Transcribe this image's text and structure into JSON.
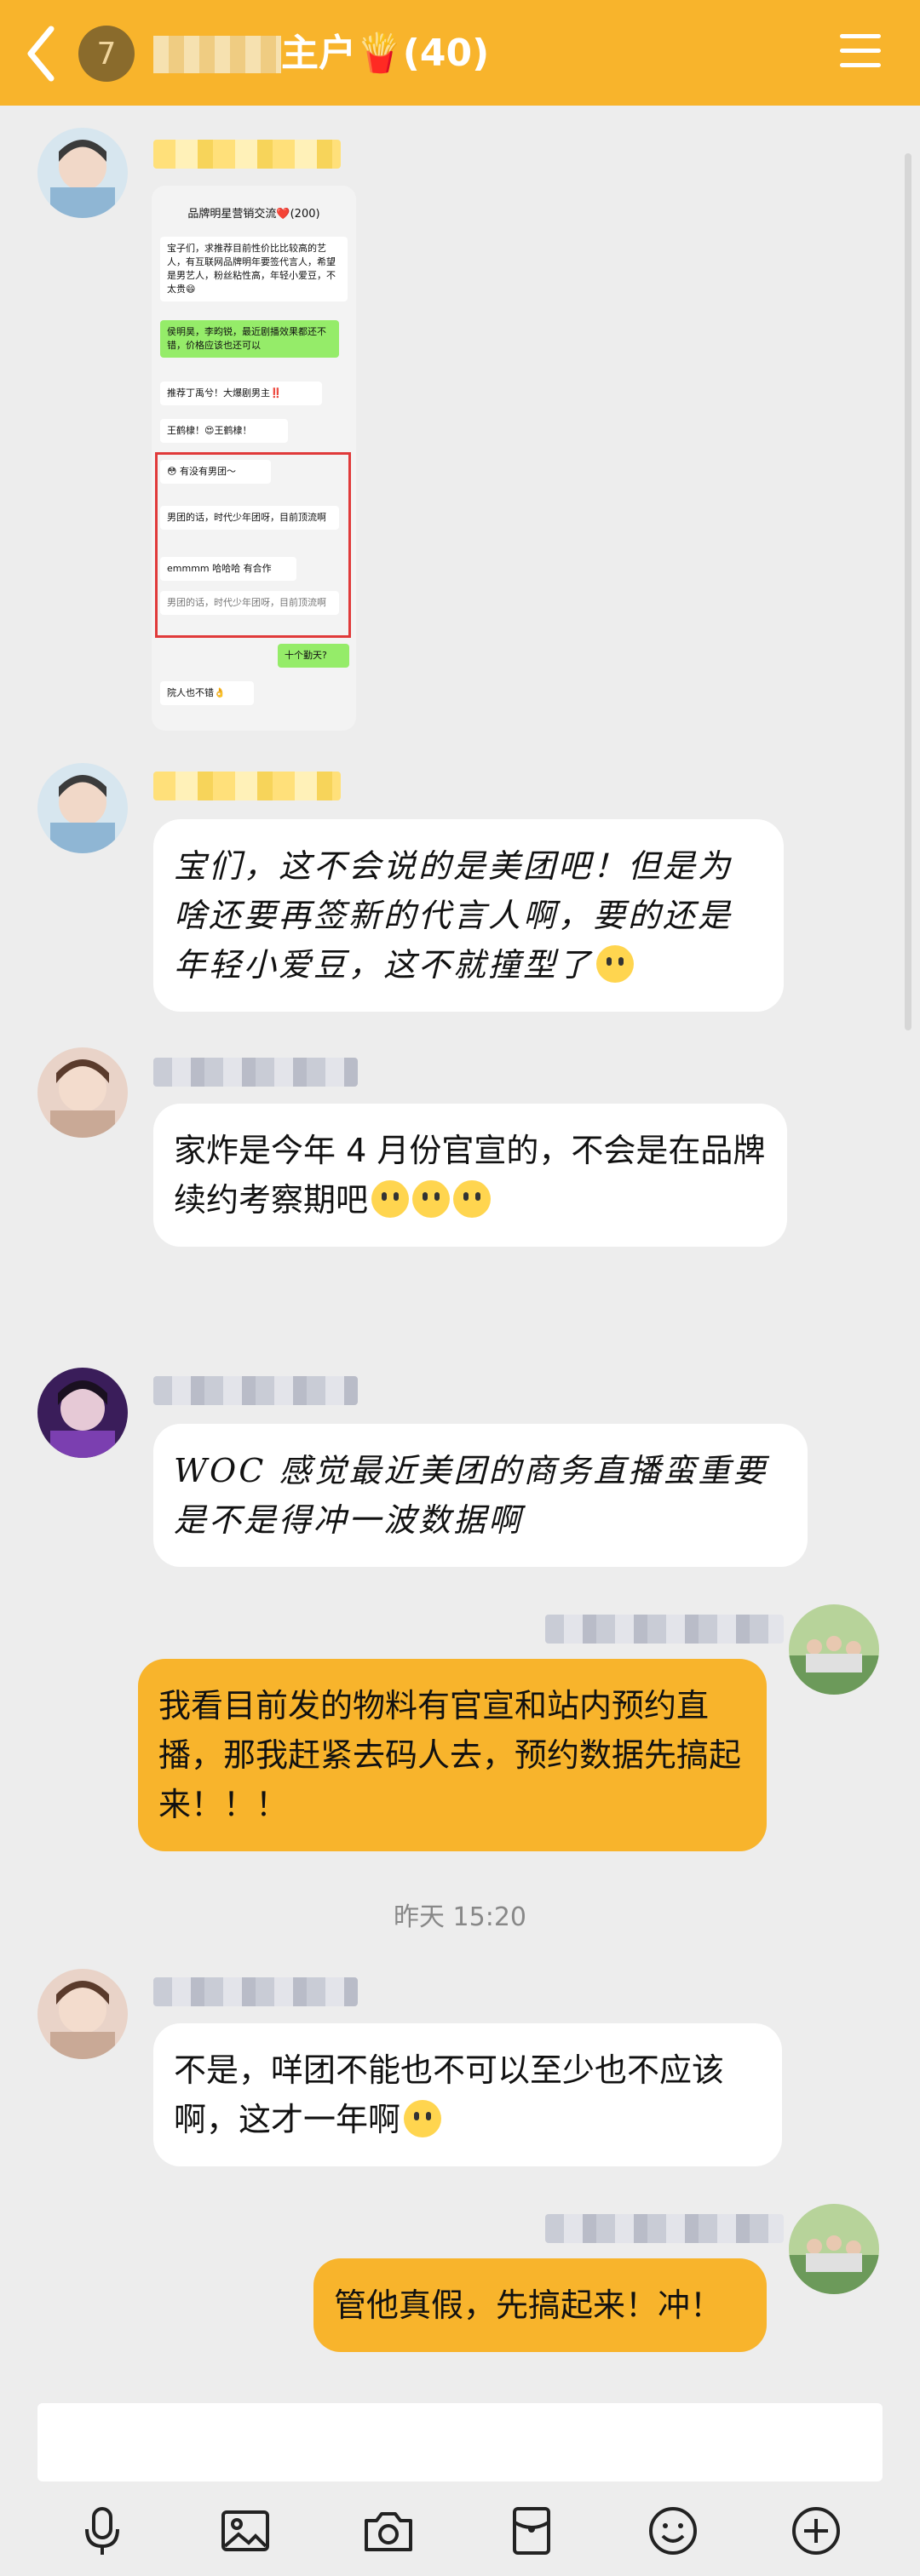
{
  "header": {
    "badge": "7",
    "title_suffix": "主户🍟(40)"
  },
  "shot": {
    "title": "品牌明星营销交流❤️(200)",
    "messages": [
      "宝子们，求推荐目前性价比比较高的艺人，有互联网品牌明年要签代言人，希望是男艺人，粉丝粘性高，年轻小爱豆，不太贵😄",
      "侯明昊，李昀锐，最近剧播效果都还不错，价格应该也还可以",
      "推荐丁禹兮！大爆剧男主‼️",
      "王鹤棣！😍王鹤棣！",
      "😳 有没有男团～",
      "男团的话，时代少年团呀，目前顶流啊",
      "emmmm 哈哈哈 有合作",
      "男团的话，时代少年团呀，目前顶流啊",
      "十个勤天?",
      "院人也不错👌"
    ]
  },
  "messages": [
    {
      "text": "宝们，这不会说的是美团吧！但是为啥还要再签新的代言人啊，要的还是年轻小爱豆，这不就撞型了"
    },
    {
      "text": "家炸是今年 4 月份官宣的，不会是在品牌续约考察期吧"
    },
    {
      "text": "WOC 感觉最近美团的商务直播蛮重要 是不是得冲一波数据啊"
    },
    {
      "text": "我看目前发的物料有官宣和站内预约直播，那我赶紧去码人去，预约数据先搞起来！！！"
    },
    {
      "text": "不是，咩团不能也不可以至少也不应该啊，这才一年啊"
    },
    {
      "text": "管他真假，先搞起来！冲！"
    }
  ],
  "timestamp": "昨天 15:20",
  "toolbar": [
    "microphone-icon",
    "image-icon",
    "camera-icon",
    "red-packet-icon",
    "emoji-icon",
    "plus-icon"
  ],
  "colors": {
    "accent": "#f8b42c",
    "background": "#ededed"
  }
}
